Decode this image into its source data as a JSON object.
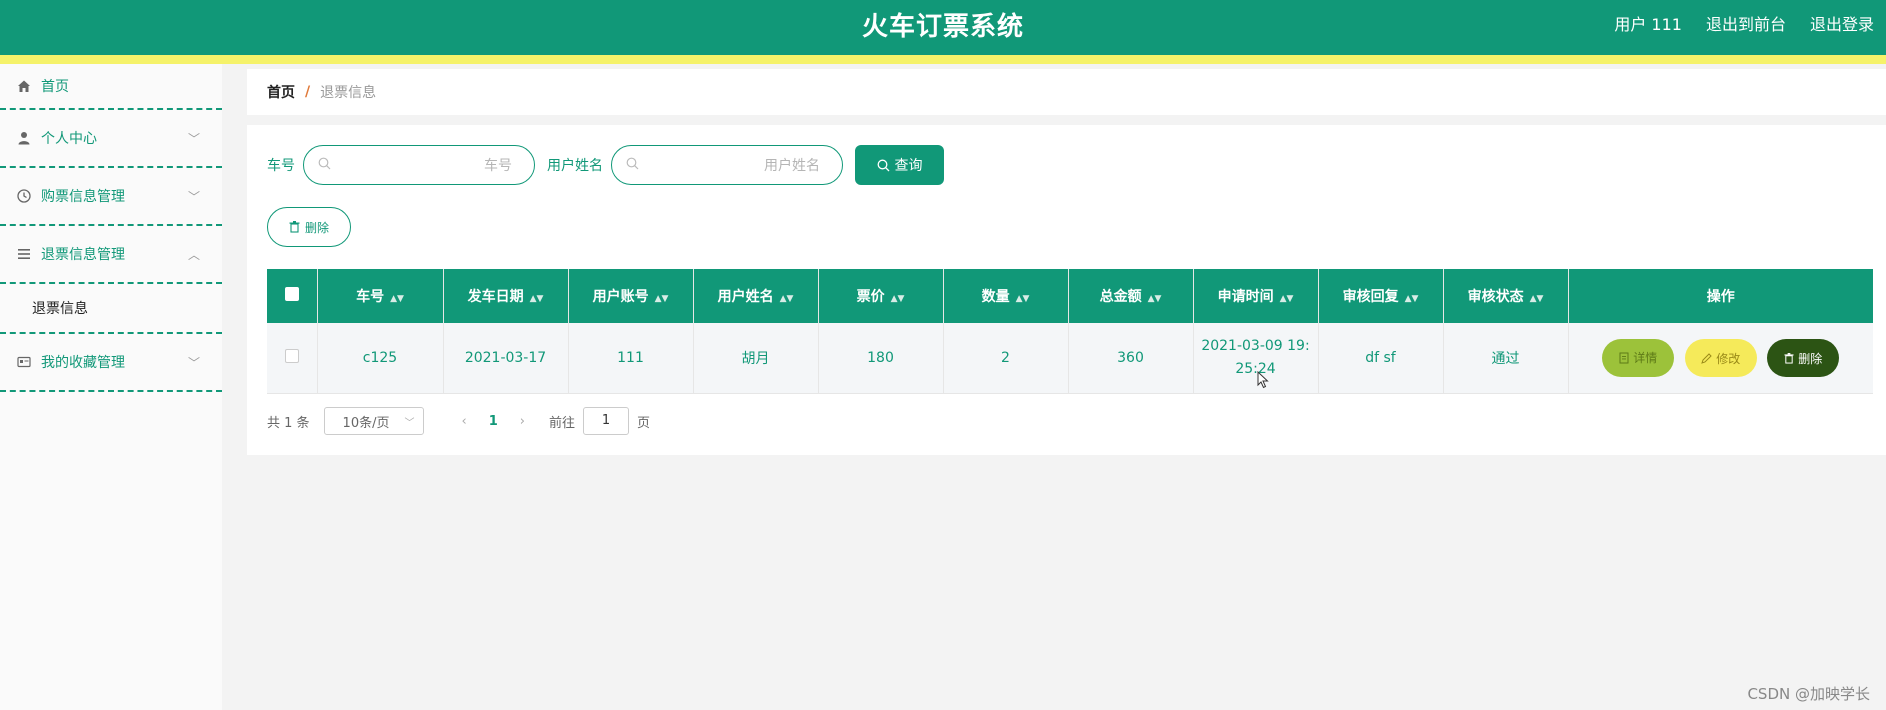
{
  "header": {
    "title": "火车订票系统",
    "user_label": "用户 111",
    "front_label": "退出到前台",
    "logout_label": "退出登录"
  },
  "sidebar": {
    "items": [
      {
        "label": "首页",
        "icon": "home-icon"
      },
      {
        "label": "个人中心",
        "icon": "user-icon"
      },
      {
        "label": "购票信息管理",
        "icon": "clock-icon"
      },
      {
        "label": "退票信息管理",
        "icon": "list-icon"
      },
      {
        "label": "我的收藏管理",
        "icon": "card-icon"
      }
    ],
    "sub_item": "退票信息"
  },
  "breadcrumb": {
    "home": "首页",
    "separator": "/",
    "current": "退票信息"
  },
  "search": {
    "train_label": "车号",
    "train_placeholder": "车号",
    "name_label": "用户姓名",
    "name_placeholder": "用户姓名",
    "query_label": "查询",
    "delete_label": "删除"
  },
  "table": {
    "headers": [
      "车号",
      "发车日期",
      "用户账号",
      "用户姓名",
      "票价",
      "数量",
      "总金额",
      "申请时间",
      "审核回复",
      "审核状态",
      "操作"
    ],
    "rows": [
      {
        "train": "c125",
        "date": "2021-03-17",
        "account": "111",
        "name": "胡月",
        "price": "180",
        "qty": "2",
        "total": "360",
        "apply_time_line1": "2021-03-09 19:",
        "apply_time_line2": "25:24",
        "reply": "df sf",
        "status": "通过"
      }
    ],
    "actions": {
      "detail": "详情",
      "edit": "修改",
      "delete": "删除"
    }
  },
  "pager": {
    "total": "共 1 条",
    "page_size": "10条/页",
    "current_page": "1",
    "goto_label": "前往",
    "goto_value": "1",
    "page_suffix": "页"
  },
  "watermark": "CSDN @加映学长",
  "colors": {
    "primary": "#119878",
    "stripe": "#f5f26a",
    "detail": "#9cc23a",
    "edit": "#f5ea5a",
    "delete": "#2c5414"
  }
}
